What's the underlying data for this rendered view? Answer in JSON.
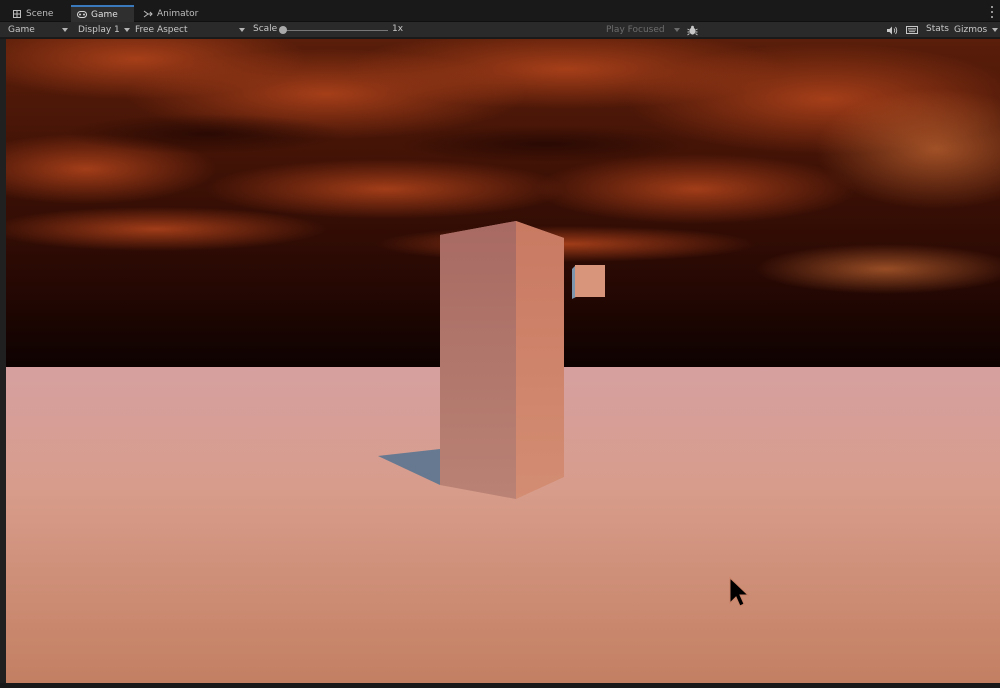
{
  "tabs": [
    {
      "label": "Scene",
      "icon": "grid-icon"
    },
    {
      "label": "Game",
      "icon": "gamepad-icon"
    },
    {
      "label": "Animator",
      "icon": "animator-icon"
    }
  ],
  "toolbar": {
    "view_mode": "Game",
    "display": "Display 1",
    "aspect": "Free Aspect",
    "scale_label": "Scale",
    "scale_value": "1x",
    "play_mode": "Play Focused",
    "stats_label": "Stats",
    "gizmos_label": "Gizmos"
  },
  "colors": {
    "accent": "#3a79bb",
    "ground": "#d79c8a",
    "sky_top": "#3c1207",
    "sky_bottom": "#120302"
  }
}
